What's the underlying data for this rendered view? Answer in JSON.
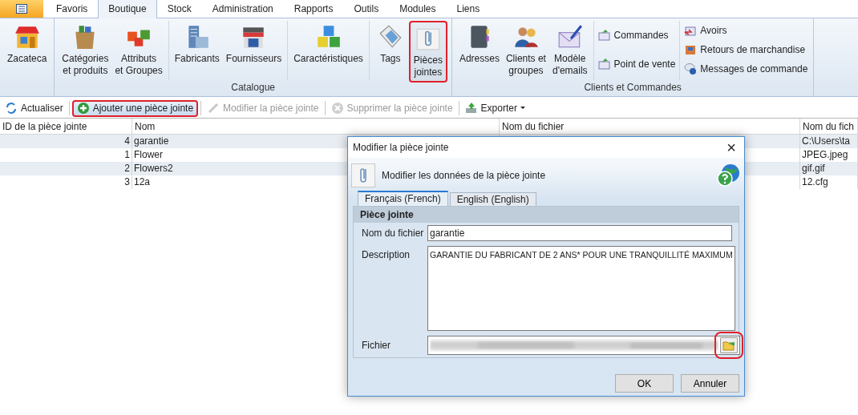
{
  "app_tabs": [
    {
      "label": "Favoris",
      "selected": false
    },
    {
      "label": "Boutique",
      "selected": true
    },
    {
      "label": "Stock",
      "selected": false
    },
    {
      "label": "Administration",
      "selected": false
    },
    {
      "label": "Rapports",
      "selected": false
    },
    {
      "label": "Outils",
      "selected": false
    },
    {
      "label": "Modules",
      "selected": false
    },
    {
      "label": "Liens",
      "selected": false
    }
  ],
  "ribbon": {
    "groups": [
      {
        "sections": [
          [
            {
              "label": "Zacateca",
              "kind": "large"
            }
          ]
        ]
      },
      {
        "label": "Catalogue",
        "sections": [
          [
            {
              "label": "Catégories\net produits",
              "kind": "large"
            },
            {
              "label": "Attributs\net Groupes",
              "kind": "large"
            }
          ],
          [
            {
              "label": "Fabricants",
              "kind": "large"
            },
            {
              "label": "Fournisseurs",
              "kind": "large"
            }
          ],
          [
            {
              "label": "Caractéristiques",
              "kind": "large"
            }
          ],
          [
            {
              "label": "Tags",
              "kind": "large"
            },
            {
              "label": "Pièces\njointes",
              "kind": "large",
              "highlighted": true
            }
          ]
        ]
      },
      {
        "label": "Clients et Commandes",
        "sections": [
          [
            {
              "label": "Adresses",
              "kind": "large"
            },
            {
              "label": "Clients et\ngroupes",
              "kind": "large"
            },
            {
              "label": "Modèle\nd'emails",
              "kind": "large"
            }
          ],
          [
            {
              "label": "Commandes",
              "kind": "small"
            },
            {
              "label": "Point de vente",
              "kind": "small"
            }
          ],
          [
            {
              "label": "Avoirs",
              "kind": "small"
            },
            {
              "label": "Retours de marchandise",
              "kind": "small"
            },
            {
              "label": "Messages de commande",
              "kind": "small"
            }
          ]
        ]
      }
    ]
  },
  "toolbar": [
    {
      "label": "Actualiser",
      "disabled": false
    },
    {
      "label": "Ajouter une pièce jointe",
      "disabled": false,
      "highlighted": true
    },
    {
      "label": "Modifier la pièce jointe",
      "disabled": true
    },
    {
      "label": "Supprimer la pièce jointe",
      "disabled": true
    },
    {
      "label": "Exporter",
      "disabled": false,
      "dropdown": true
    }
  ],
  "table": {
    "columns": [
      "ID de la pièce jointe",
      "Nom",
      "Nom du fichier",
      "Nom du fich"
    ],
    "rows": [
      {
        "id": "4",
        "name": "garantie",
        "column_4": "C:\\Users\\ta"
      },
      {
        "id": "1",
        "name": "Flower",
        "column_4": "JPEG.jpeg"
      },
      {
        "id": "2",
        "name": "Flowers2",
        "column_4": "gif.gif"
      },
      {
        "id": "3",
        "name": "12a",
        "column_4": "12.cfg"
      }
    ]
  },
  "dialog": {
    "title": "Modifier la pièce jointe",
    "close": "×",
    "header": "Modifier les données de la pièce jointe",
    "tabs": [
      {
        "label": "Français (French)",
        "selected": true
      },
      {
        "label": "English (English)",
        "selected": false
      }
    ],
    "section": "Pièce jointe",
    "fields": [
      {
        "label": "Nom du fichier",
        "kind": "text",
        "value": "garantie"
      },
      {
        "label": "Description",
        "kind": "textarea",
        "value": "GARANTIE DU FABRICANT DE 2 ANS* POUR UNE TRANQUILLITÉ MAXIMUM"
      },
      {
        "label": "Fichier",
        "kind": "file",
        "browse_highlighted": true
      }
    ],
    "buttons": [
      "OK",
      "Annuler"
    ]
  }
}
